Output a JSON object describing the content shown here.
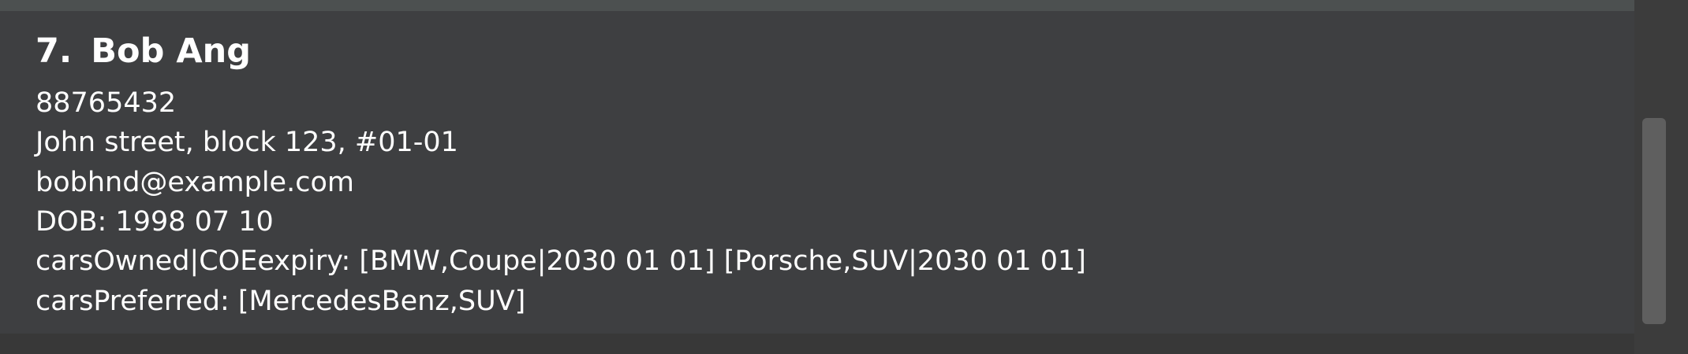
{
  "person": {
    "index": "7.",
    "name": "Bob Ang",
    "phone": "88765432",
    "address": "John street, block 123, #01-01",
    "email": "bobhnd@example.com",
    "dob": "DOB: 1998 07 10",
    "cars_owned": "carsOwned|COEexpiry: [BMW,Coupe|2030 01 01] [Porsche,SUV|2030 01 01]",
    "cars_preferred": "carsPreferred: [MercedesBenz,SUV]"
  },
  "colors": {
    "card_background": "#3e3f41",
    "text": "#ffffff",
    "scrollbar_thumb": "#5f5f5f"
  }
}
